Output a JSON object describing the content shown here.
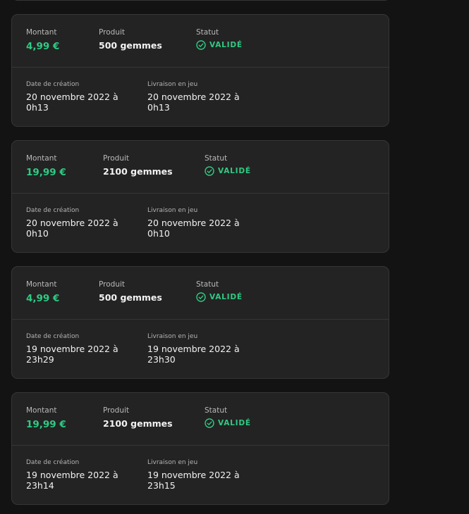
{
  "labels": {
    "amount": "Montant",
    "product": "Produit",
    "status": "Statut",
    "created": "Date de création",
    "delivery": "Livraison en jeu"
  },
  "colors": {
    "accent": "#2fca83",
    "background": "#131313",
    "card": "#232323",
    "border": "#363636"
  },
  "orders": [
    {
      "amount": "4,99 €",
      "product": "500 gemmes",
      "status": "VALIDÉ",
      "status_icon": "check-circle-icon",
      "created": "20 novembre 2022 à 0h13",
      "delivered": "20 novembre 2022 à 0h13"
    },
    {
      "amount": "19,99 €",
      "product": "2100 gemmes",
      "status": "VALIDÉ",
      "status_icon": "check-circle-icon",
      "created": "20 novembre 2022 à 0h10",
      "delivered": "20 novembre 2022 à 0h10"
    },
    {
      "amount": "4,99 €",
      "product": "500 gemmes",
      "status": "VALIDÉ",
      "status_icon": "check-circle-icon",
      "created": "19 novembre 2022 à 23h29",
      "delivered": "19 novembre 2022 à 23h30"
    },
    {
      "amount": "19,99 €",
      "product": "2100 gemmes",
      "status": "VALIDÉ",
      "status_icon": "check-circle-icon",
      "created": "19 novembre 2022 à 23h14",
      "delivered": "19 novembre 2022 à 23h15"
    }
  ]
}
